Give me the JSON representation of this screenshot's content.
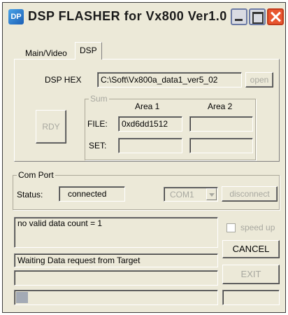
{
  "window": {
    "title": "DSP FLASHER for Vx800  Ver1.0",
    "icon_text": "DP"
  },
  "tabs": [
    {
      "label": "Main/Video",
      "active": false
    },
    {
      "label": "DSP",
      "active": true
    }
  ],
  "dsp": {
    "hex_label": "DSP HEX",
    "hex_path": "C:\\Soft\\Vx800a_data1_ver5_02",
    "open_label": "open",
    "rdy_label": "RDY",
    "sum": {
      "title": "Sum",
      "area1_label": "Area 1",
      "area2_label": "Area 2",
      "file_label": "FILE:",
      "set_label": "SET:",
      "file_area1": "0xd6dd1512",
      "file_area2": "",
      "set_area1": "",
      "set_area2": ""
    }
  },
  "com_port": {
    "title": "Com Port",
    "status_label": "Status:",
    "status_value": "connected",
    "port_selected": "COM1",
    "disconnect_label": "disconnect"
  },
  "log": {
    "line1": "no valid data count = 1",
    "line2": "Waiting Data request from Target",
    "line3": ""
  },
  "controls": {
    "speed_up_label": "speed up",
    "cancel_label": "CANCEL",
    "exit_label": "EXIT",
    "bottom_field": ""
  },
  "progress": {
    "fraction": 0.06
  },
  "colors": {
    "window_bg": "#ece9d8",
    "close_button": "#e8552f",
    "disabled_text": "#a8a8a0",
    "progress_fill": "#a3aab5"
  },
  "icons": [
    "app-icon",
    "minimize-icon",
    "maximize-icon",
    "close-icon",
    "chevron-down-icon"
  ]
}
